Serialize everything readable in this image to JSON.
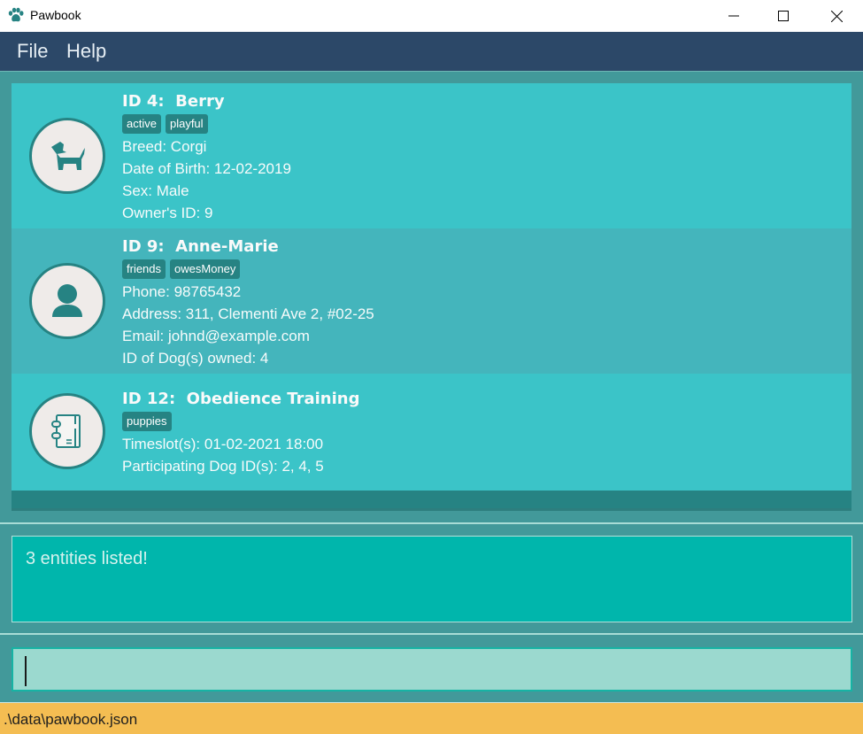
{
  "window": {
    "title": "Pawbook",
    "icon": "paw-icon",
    "controls": {
      "minimize": "minimize-icon",
      "maximize": "maximize-icon",
      "close": "close-icon"
    }
  },
  "menu": {
    "items": [
      {
        "label": "File"
      },
      {
        "label": "Help"
      }
    ]
  },
  "entities": [
    {
      "type": "dog",
      "icon": "dog-icon",
      "title": "ID 4:  Berry",
      "tags": [
        "active",
        "playful"
      ],
      "fields": [
        "Breed: Corgi",
        "Date of Birth: 12-02-2019",
        "Sex: Male",
        "Owner's ID: 9"
      ]
    },
    {
      "type": "owner",
      "icon": "person-icon",
      "title": "ID 9:  Anne-Marie",
      "tags": [
        "friends",
        "owesMoney"
      ],
      "fields": [
        "Phone: 98765432",
        "Address: 311, Clementi Ave 2, #02-25",
        "Email: johnd@example.com",
        "ID of Dog(s) owned: 4"
      ]
    },
    {
      "type": "program",
      "icon": "notebook-icon",
      "title": "ID 12:  Obedience Training",
      "tags": [
        "puppies"
      ],
      "fields": [
        "Timeslot(s): 01-02-2021 18:00",
        "Participating Dog ID(s): 2, 4, 5"
      ]
    }
  ],
  "result": {
    "message": "3 entities listed!"
  },
  "command": {
    "value": "",
    "placeholder": ""
  },
  "status": {
    "file_path": ".\\data\\pawbook.json"
  },
  "colors": {
    "menubar": "#2c4868",
    "panel": "#42999a",
    "card": "#3bc4c8",
    "card_alt": "#44b5bc",
    "tag": "#268383",
    "result_bg": "#00b6ac",
    "command_bg": "#9bd9cf",
    "statusbar": "#f4bd52"
  }
}
